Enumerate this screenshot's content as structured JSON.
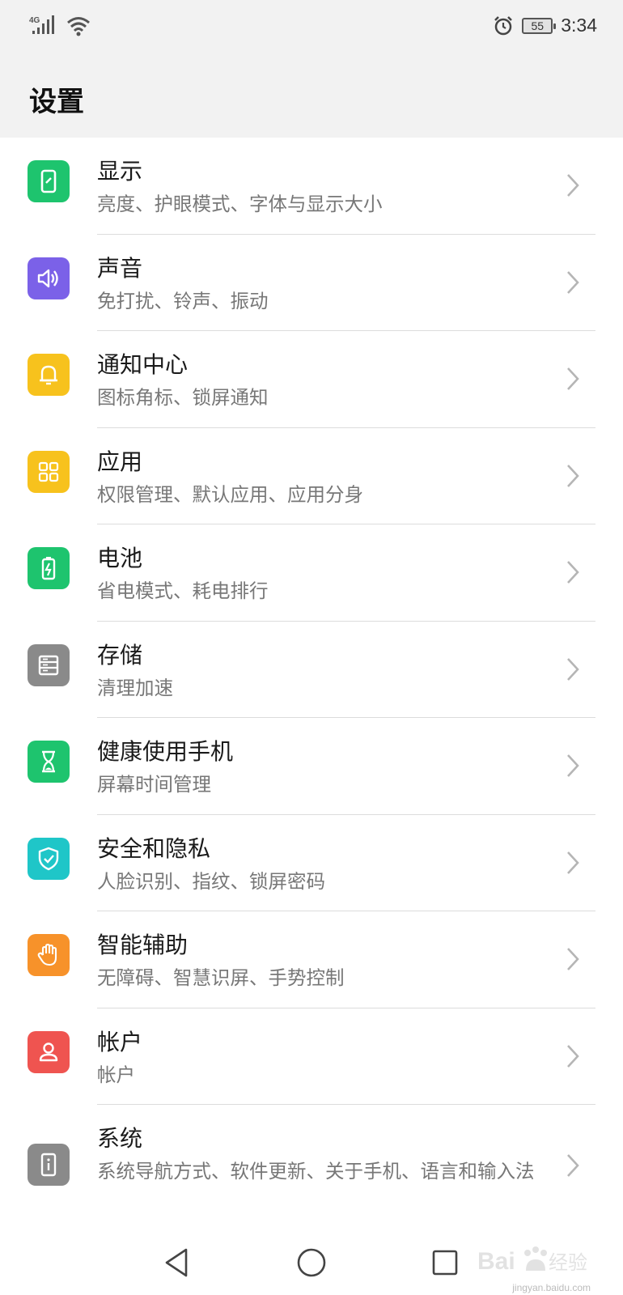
{
  "status_bar": {
    "network": "4G",
    "battery": "55",
    "time": "3:34",
    "icons": [
      "signal-icon",
      "wifi-icon",
      "alarm-icon",
      "battery-icon"
    ]
  },
  "header": {
    "title": "设置"
  },
  "settings": [
    {
      "title": "显示",
      "subtitle": "亮度、护眼模式、字体与显示大小",
      "icon": "display-icon",
      "color": "#1ec46e"
    },
    {
      "title": "声音",
      "subtitle": "免打扰、铃声、振动",
      "icon": "speaker-icon",
      "color": "#7b61e8"
    },
    {
      "title": "通知中心",
      "subtitle": "图标角标、锁屏通知",
      "icon": "bell-icon",
      "color": "#f7c21d"
    },
    {
      "title": "应用",
      "subtitle": "权限管理、默认应用、应用分身",
      "icon": "apps-grid-icon",
      "color": "#f7c21d"
    },
    {
      "title": "电池",
      "subtitle": "省电模式、耗电排行",
      "icon": "battery-icon",
      "color": "#1ec46e"
    },
    {
      "title": "存储",
      "subtitle": "清理加速",
      "icon": "storage-icon",
      "color": "#8a8a8a"
    },
    {
      "title": "健康使用手机",
      "subtitle": "屏幕时间管理",
      "icon": "hourglass-icon",
      "color": "#1ec46e"
    },
    {
      "title": "安全和隐私",
      "subtitle": "人脸识别、指纹、锁屏密码",
      "icon": "shield-icon",
      "color": "#1fc6c8"
    },
    {
      "title": "智能辅助",
      "subtitle": "无障碍、智慧识屏、手势控制",
      "icon": "hand-icon",
      "color": "#f7922a"
    },
    {
      "title": "帐户",
      "subtitle": "帐户",
      "icon": "person-icon",
      "color": "#ef5450"
    },
    {
      "title": "系统",
      "subtitle": "系统导航方式、软件更新、关于手机、语言和输入法",
      "icon": "phone-info-icon",
      "color": "#8a8a8a"
    }
  ],
  "nav_bar": {
    "icons": [
      "back-icon",
      "home-icon",
      "recents-icon"
    ]
  },
  "watermark": {
    "text": "jingyan.baidu.com"
  }
}
